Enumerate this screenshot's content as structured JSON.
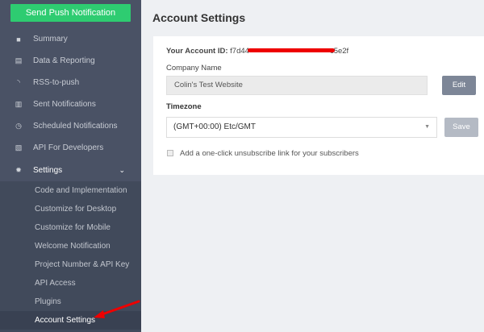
{
  "sidebar": {
    "send_button": "Send Push Notification",
    "items": [
      {
        "label": "Summary",
        "icon": "grid-icon"
      },
      {
        "label": "Data & Reporting",
        "icon": "document-icon"
      },
      {
        "label": "RSS-to-push",
        "icon": "rss-icon"
      },
      {
        "label": "Sent Notifications",
        "icon": "bar-chart-icon"
      },
      {
        "label": "Scheduled Notifications",
        "icon": "clock-icon"
      },
      {
        "label": "API For Developers",
        "icon": "api-document-icon"
      },
      {
        "label": "Settings",
        "icon": "gear-icon"
      }
    ],
    "sub_items": [
      "Code and Implementation",
      "Customize for Desktop",
      "Customize for Mobile",
      "Welcome Notification",
      "Project Number & API Key",
      "API Access",
      "Plugins",
      "Account Settings"
    ]
  },
  "main": {
    "title": "Account Settings",
    "account_id_label": "Your Account ID:",
    "account_id_value": "f7d44",
    "account_id_suffix": "c5e2f",
    "company_label": "Company Name",
    "company_value": "Colin's Test Website",
    "edit_label": "Edit",
    "timezone_label": "Timezone",
    "timezone_value": "(GMT+00:00) Etc/GMT",
    "save_label": "Save",
    "checkbox_label": "Add a one-click unsubscribe link for your subscribers"
  },
  "colors": {
    "accent": "#2ecc71",
    "sidebar": "#4a5265",
    "annotation": "#e00000"
  }
}
